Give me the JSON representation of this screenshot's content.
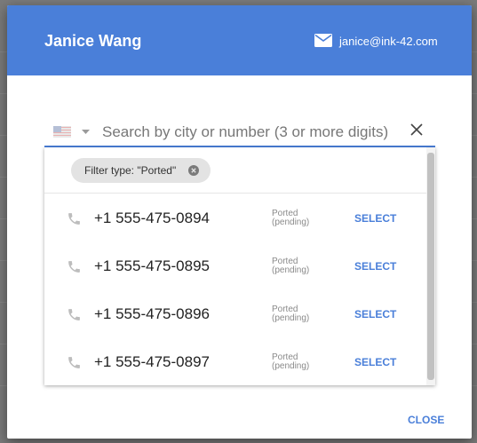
{
  "user": {
    "name": "Janice Wang",
    "email": "janice@ink-42.com"
  },
  "search": {
    "placeholder": "Search by city or number (3 or more digits)"
  },
  "filter": {
    "chip_label": "Filter type: \"Ported\""
  },
  "numbers": [
    {
      "number": "+1 555-475-0894",
      "status_line1": "Ported",
      "status_line2": "(pending)",
      "action": "SELECT"
    },
    {
      "number": "+1 555-475-0895",
      "status_line1": "Ported",
      "status_line2": "(pending)",
      "action": "SELECT"
    },
    {
      "number": "+1 555-475-0896",
      "status_line1": "Ported",
      "status_line2": "(pending)",
      "action": "SELECT"
    },
    {
      "number": "+1 555-475-0897",
      "status_line1": "Ported",
      "status_line2": "(pending)",
      "action": "SELECT"
    }
  ],
  "footer": {
    "close_label": "CLOSE"
  },
  "colors": {
    "accent": "#4a7fd9",
    "backdrop": "#7a7a7a",
    "chip": "#e3e3e3"
  },
  "icons": {
    "mail": "mail-icon",
    "flag": "us-flag-icon",
    "caret": "chevron-down-icon",
    "clear": "close-icon",
    "chip_remove": "chip-close-icon",
    "phone": "phone-icon"
  }
}
